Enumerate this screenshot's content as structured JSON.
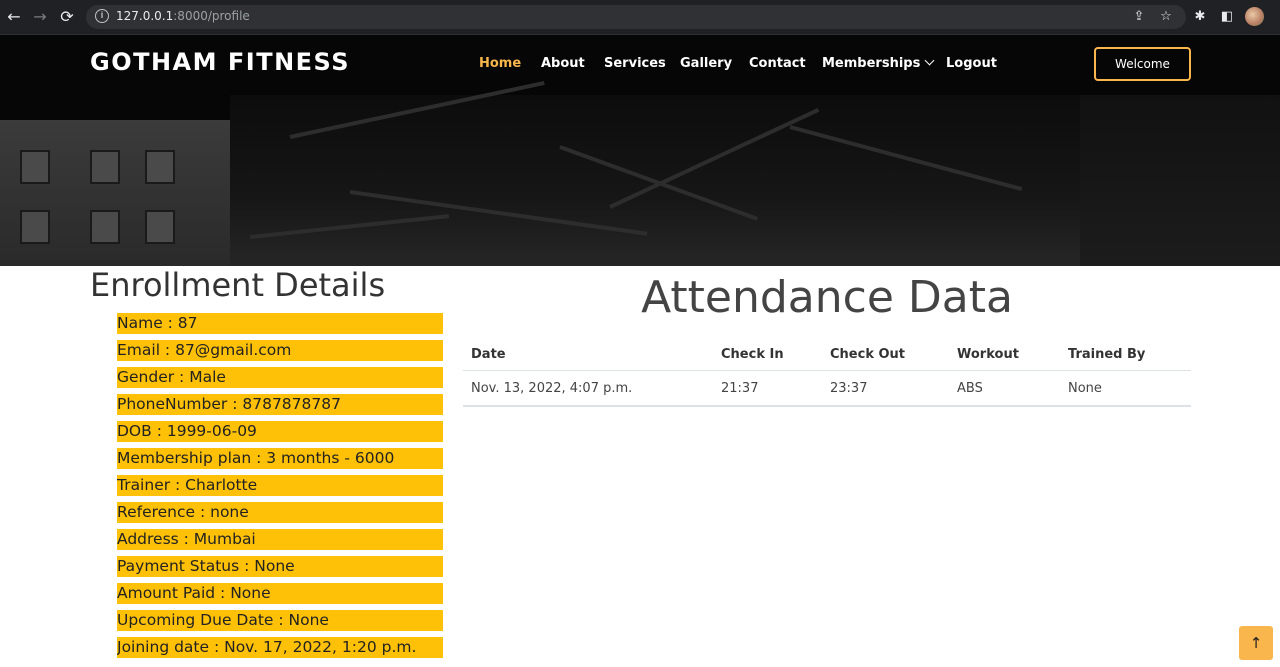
{
  "browser": {
    "url_host": "127.0.0.1",
    "url_path": ":8000/profile",
    "icons": [
      "back-icon",
      "forward-icon",
      "reload-icon",
      "info-icon",
      "share-icon",
      "star-icon",
      "extensions-icon",
      "sidepanel-icon",
      "profile-avatar"
    ]
  },
  "navbar": {
    "brand": "GOTHAM FITNESS",
    "items": [
      {
        "label": "Home",
        "active": true
      },
      {
        "label": "About"
      },
      {
        "label": "Services"
      },
      {
        "label": "Gallery"
      },
      {
        "label": "Contact"
      },
      {
        "label": "Memberships"
      },
      {
        "label": "Logout"
      }
    ],
    "welcome_button": "Welcome"
  },
  "enrollment": {
    "title": "Enrollment Details",
    "items": [
      "Name : 87",
      "Email : 87@gmail.com",
      "Gender : Male",
      "PhoneNumber : 8787878787",
      "DOB : 1999-06-09",
      "Membership plan : 3 months - 6000",
      "Trainer : Charlotte",
      "Reference : none",
      "Address : Mumbai",
      "Payment Status : None",
      "Amount Paid : None",
      "Upcoming Due Date : None",
      "Joining date : Nov. 17, 2022, 1:20 p.m."
    ]
  },
  "attendance": {
    "title": "Attendance Data",
    "columns": [
      "Date",
      "Check In",
      "Check Out",
      "Workout",
      "Trained By"
    ],
    "rows": [
      [
        "Nov. 13, 2022, 4:07 p.m.",
        "21:37",
        "23:37",
        "ABS",
        "None"
      ]
    ]
  },
  "colors": {
    "accent": "#f8b64c",
    "highlight": "#ffc107"
  },
  "scroll_top_icon": "arrow-up-icon"
}
